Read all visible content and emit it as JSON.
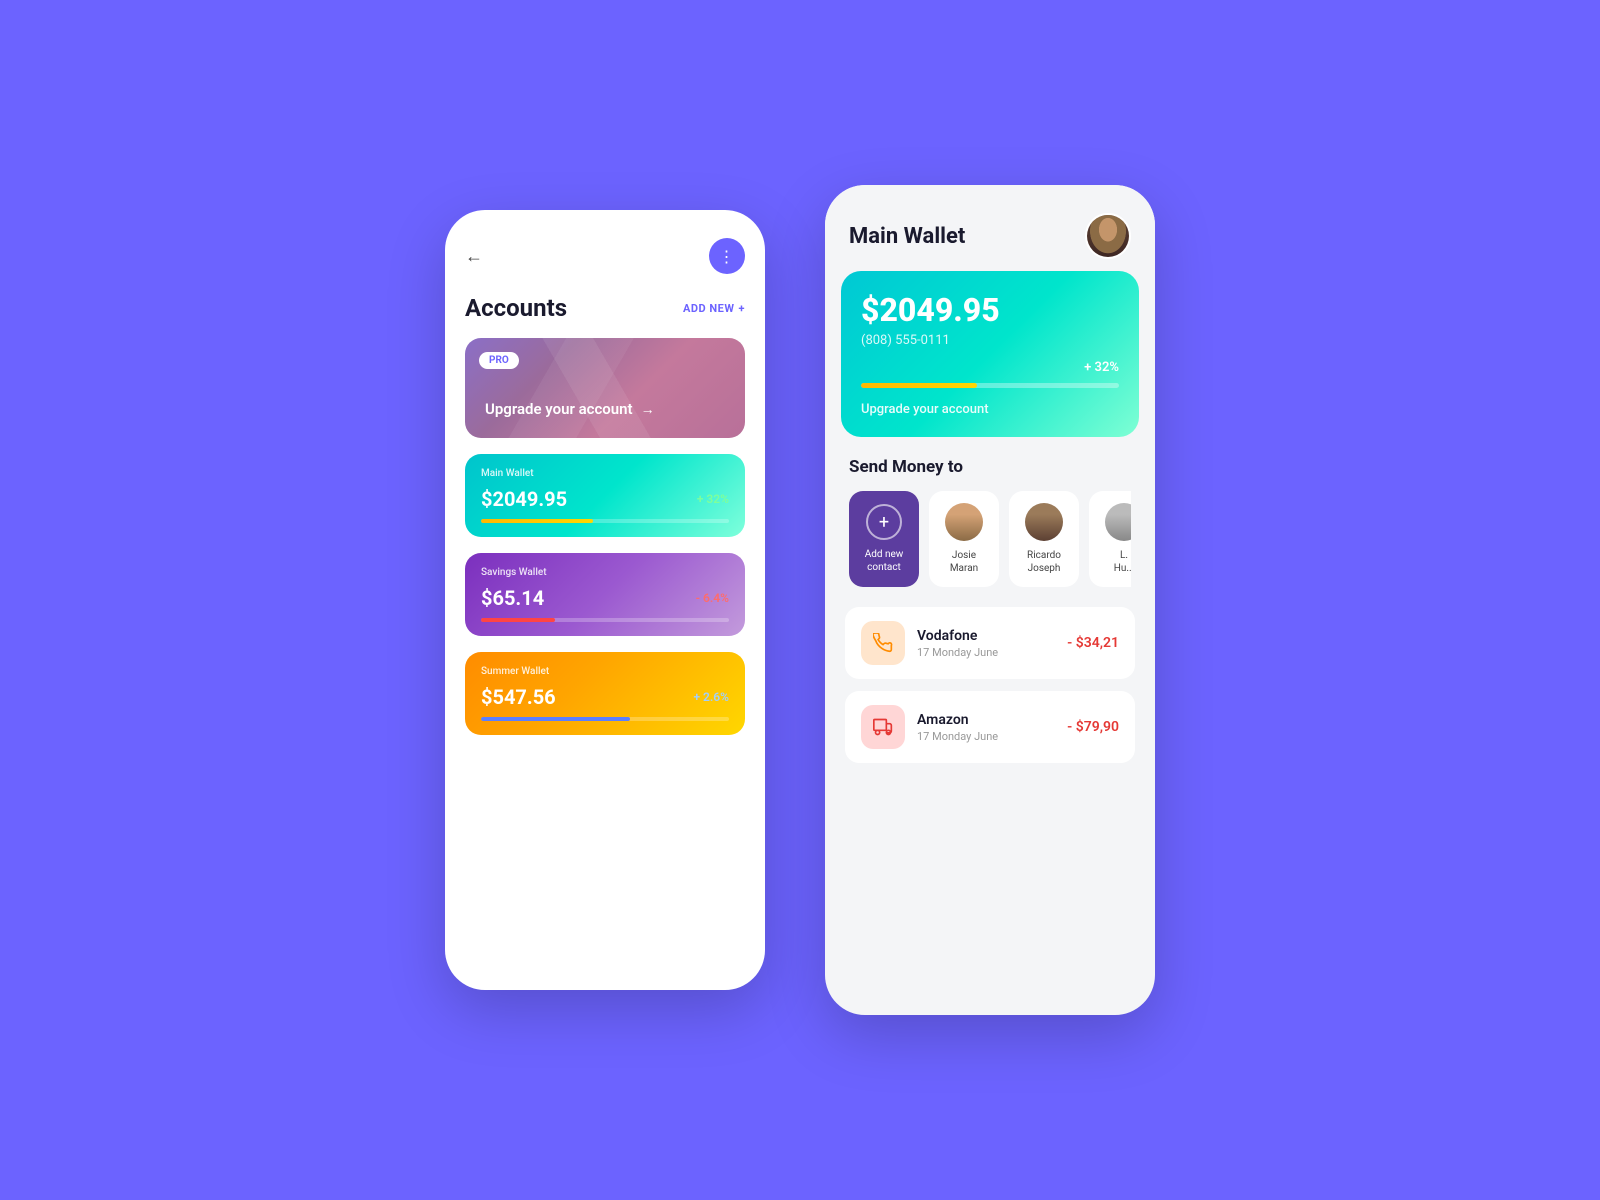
{
  "background": "#6C63FF",
  "left_phone": {
    "back_icon": "←",
    "menu_icon": "⋮",
    "accounts_title": "Accounts",
    "add_new_label": "ADD NEW",
    "add_new_icon": "+",
    "pro_badge": "PRO",
    "upgrade_label": "Upgrade your account",
    "upgrade_arrow": "→",
    "wallets": [
      {
        "name": "Main Wallet",
        "amount": "$2049.95",
        "percent": "+ 32%",
        "percent_type": "green",
        "progress": 45,
        "progress_color": "#FFB800"
      },
      {
        "name": "Savings Wallet",
        "amount": "$65.14",
        "percent": "- 6.4%",
        "percent_type": "red",
        "progress": 30,
        "progress_color": "#FF4444"
      },
      {
        "name": "Summer Wallet",
        "amount": "$547.56",
        "percent": "+ 2.6%",
        "percent_type": "blue",
        "progress": 60,
        "progress_color": "#5B7FFF"
      }
    ]
  },
  "right_phone": {
    "title": "Main Wallet",
    "balance": "$2049.95",
    "phone": "(808) 555-0111",
    "percent_badge": "+ 32%",
    "progress": 45,
    "upgrade_label": "Upgrade your account",
    "send_money_title": "Send Money to",
    "add_contact_label": "Add new\ncontact",
    "contacts": [
      {
        "name": "Josie\nMaran",
        "avatar_color": "#D4A276"
      },
      {
        "name": "Ricardo\nJoseph",
        "avatar_color": "#8B6B45"
      },
      {
        "name": "L.\nHun...",
        "avatar_color": "#AAAAAA"
      }
    ],
    "transactions": [
      {
        "name": "Vodafone",
        "date": "17 Monday June",
        "amount": "- $34,21",
        "icon": "📞",
        "icon_type": "vodafone"
      },
      {
        "name": "Amazon",
        "date": "17 Monday June",
        "amount": "- $79,90",
        "icon": "🛒",
        "icon_type": "amazon"
      }
    ]
  }
}
